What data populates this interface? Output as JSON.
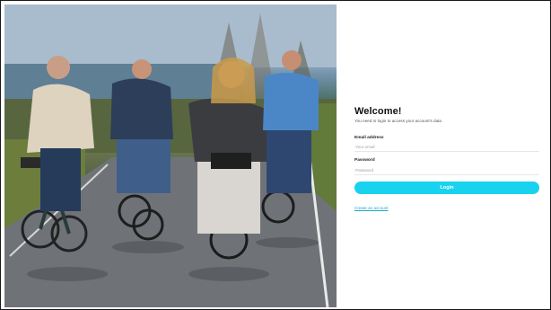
{
  "hero": {
    "image_subject": "four-people-riding-bicycles-on-path"
  },
  "login": {
    "title": "Welcome!",
    "subtitle": "You need to login to access your account's data",
    "email_label": "Email address",
    "email_placeholder": "Your email",
    "password_label": "Password",
    "password_placeholder": "Password",
    "login_button": "Login",
    "create_account_link": "Create an account"
  },
  "colors": {
    "accent": "#19d3ee",
    "link": "#1aa7c4",
    "title": "#111111"
  }
}
